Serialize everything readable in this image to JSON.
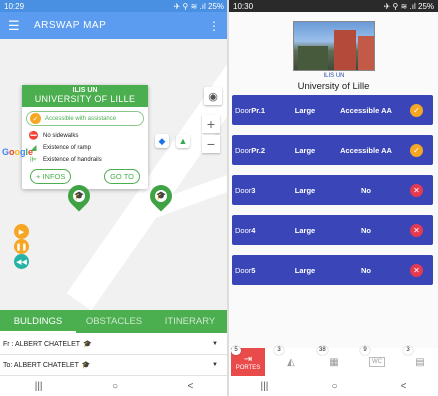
{
  "left": {
    "status": {
      "time": "10:29",
      "right": "✈ ⚲ ≋ .ıl 25%"
    },
    "appbar": {
      "title": "ARSWAP MAP",
      "menu_icon": "hamburger-icon",
      "more_icon": "kebab-icon"
    },
    "info": {
      "header_small": "ILIS UN",
      "header_big": "UNIVERSITY OF LILLE",
      "accessible": "Accessible with assistance",
      "rows": [
        "No sidewalks",
        "Existence of ramp",
        "Existence of handrails"
      ],
      "more_button": "+ INFOS",
      "goto_button": "GO TO"
    },
    "google": "Google",
    "tabs": [
      "BULDINGS",
      "OBSTACLES",
      "ITINERARY"
    ],
    "from": "Fr : ALBERT CHATELET",
    "to": "To: ALBERT CHATELET",
    "colors": {
      "accent": "#4bae4f",
      "appbar": "#5b9bf0"
    }
  },
  "right": {
    "status": {
      "time": "10:30",
      "right": "✈ ⚲ ≋ .ıl 25%"
    },
    "photo_label": "ILIS UN",
    "university": "University of Lille",
    "doors": [
      {
        "name_prefix": "Door",
        "name_suffix": "Pr.1",
        "size": "Large",
        "access": "Accessible AA",
        "ok": true
      },
      {
        "name_prefix": "Door",
        "name_suffix": "Pr.2",
        "size": "Large",
        "access": "Accessible AA",
        "ok": true
      },
      {
        "name_prefix": "Door",
        "name_suffix": "3",
        "size": "Large",
        "access": "No",
        "ok": false
      },
      {
        "name_prefix": "Door",
        "name_suffix": "4",
        "size": "Large",
        "access": "No",
        "ok": false
      },
      {
        "name_prefix": "Door",
        "name_suffix": "5",
        "size": "Large",
        "access": "No",
        "ok": false
      }
    ],
    "bottom_tabs": [
      {
        "badge": "5",
        "label": "PORTES"
      },
      {
        "badge": "3",
        "label": ""
      },
      {
        "badge": "38",
        "label": ""
      },
      {
        "badge": "9",
        "label": "WC"
      },
      {
        "badge": "3",
        "label": ""
      }
    ],
    "colors": {
      "door": "#3a45b8",
      "ok": "#f5a623",
      "no": "#e53950",
      "active_tab": "#e94b4b"
    }
  },
  "navbar": {
    "recent": "|||",
    "home": "○",
    "back": "<"
  }
}
